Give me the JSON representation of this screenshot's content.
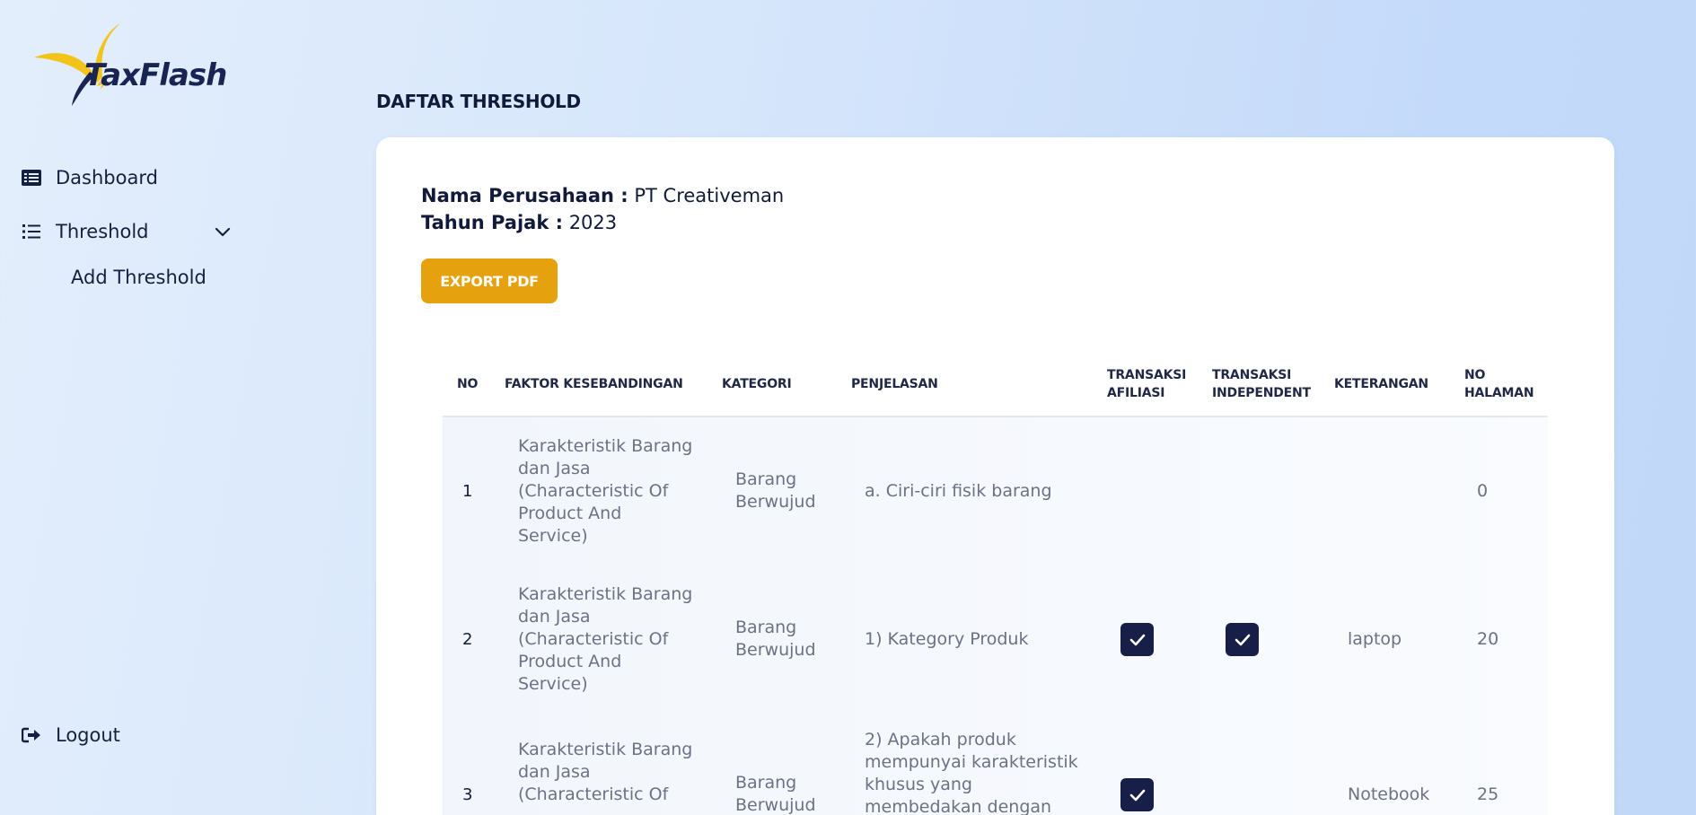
{
  "brand": {
    "name": "TaxFlash",
    "colors": {
      "navy": "#1a2452",
      "gold": "#e6a20e",
      "yellow": "#f2c318"
    }
  },
  "sidebar": {
    "items": [
      {
        "label": "Dashboard",
        "icon": "list-card-icon"
      },
      {
        "label": "Threshold",
        "icon": "list-icon",
        "expanded": true,
        "children": [
          {
            "label": "Add Threshold"
          }
        ]
      }
    ],
    "logout": {
      "label": "Logout",
      "icon": "sign-out-icon"
    }
  },
  "page": {
    "title": "DAFTAR THRESHOLD",
    "company_label": "Nama Perusahaan :",
    "company_value": "PT Creativeman",
    "year_label": "Tahun Pajak :",
    "year_value": "2023",
    "export_label": "EXPORT PDF"
  },
  "table": {
    "headers": {
      "no": "NO",
      "faktor": "FAKTOR KESEBANDINGAN",
      "kategori": "KATEGORI",
      "penjelasan": "PENJELASAN",
      "afiliasi_1": "TRANSAKSI",
      "afiliasi_2": "AFILIASI",
      "independent_1": "TRANSAKSI",
      "independent_2": "INDEPENDENT",
      "keterangan": "KETERANGAN",
      "halaman_1": "NO",
      "halaman_2": "HALAMAN"
    },
    "rows": [
      {
        "no": "1",
        "faktor": [
          "Karakteristik Barang",
          "dan Jasa",
          "(Characteristic Of",
          "Product And",
          "Service)"
        ],
        "kategori": [
          "Barang",
          "Berwujud"
        ],
        "penjelasan": [
          "a. Ciri-ciri fisik barang"
        ],
        "afiliasi": false,
        "independent": false,
        "keterangan": "",
        "halaman": "0"
      },
      {
        "no": "2",
        "faktor": [
          "Karakteristik Barang",
          "dan Jasa",
          "(Characteristic Of",
          "Product And",
          "Service)"
        ],
        "kategori": [
          "Barang",
          "Berwujud"
        ],
        "penjelasan": [
          "1) Kategory Produk"
        ],
        "afiliasi": true,
        "independent": true,
        "keterangan": "laptop",
        "halaman": "20"
      },
      {
        "no": "3",
        "faktor": [
          "Karakteristik Barang",
          "dan Jasa",
          "(Characteristic Of"
        ],
        "kategori": [
          "Barang",
          "Berwujud"
        ],
        "penjelasan": [
          "2) Apakah produk",
          "mempunyai karakteristik",
          "khusus yang",
          "membedakan dengan"
        ],
        "afiliasi": true,
        "independent": false,
        "keterangan": "Notebook",
        "halaman": "25"
      }
    ]
  }
}
